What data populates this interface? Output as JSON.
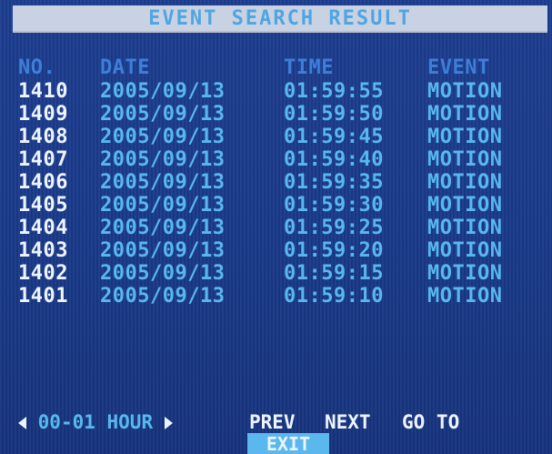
{
  "title": "EVENT SEARCH RESULT",
  "columns": {
    "no": "NO.",
    "date": "DATE",
    "time": "TIME",
    "event": "EVENT"
  },
  "rows": [
    {
      "no": "1410",
      "date": "2005/09/13",
      "time": "01:59:55",
      "event": "MOTION"
    },
    {
      "no": "1409",
      "date": "2005/09/13",
      "time": "01:59:50",
      "event": "MOTION"
    },
    {
      "no": "1408",
      "date": "2005/09/13",
      "time": "01:59:45",
      "event": "MOTION"
    },
    {
      "no": "1407",
      "date": "2005/09/13",
      "time": "01:59:40",
      "event": "MOTION"
    },
    {
      "no": "1406",
      "date": "2005/09/13",
      "time": "01:59:35",
      "event": "MOTION"
    },
    {
      "no": "1405",
      "date": "2005/09/13",
      "time": "01:59:30",
      "event": "MOTION"
    },
    {
      "no": "1404",
      "date": "2005/09/13",
      "time": "01:59:25",
      "event": "MOTION"
    },
    {
      "no": "1403",
      "date": "2005/09/13",
      "time": "01:59:20",
      "event": "MOTION"
    },
    {
      "no": "1402",
      "date": "2005/09/13",
      "time": "01:59:15",
      "event": "MOTION"
    },
    {
      "no": "1401",
      "date": "2005/09/13",
      "time": "01:59:10",
      "event": "MOTION"
    }
  ],
  "footer": {
    "hour_range": "00-01 HOUR",
    "prev": "PREV",
    "next": "NEXT",
    "go_to": "GO TO",
    "exit": "EXIT"
  },
  "icons": {
    "left": "triangle-left-icon",
    "right": "triangle-right-icon"
  },
  "colors": {
    "background": "#1a3a8c",
    "title_bar": "#c9d2e2",
    "accent": "#58b8ee",
    "header": "#3d7fd8",
    "white_text": "#eef4ff",
    "exit_highlight": "#5ab8ee"
  }
}
